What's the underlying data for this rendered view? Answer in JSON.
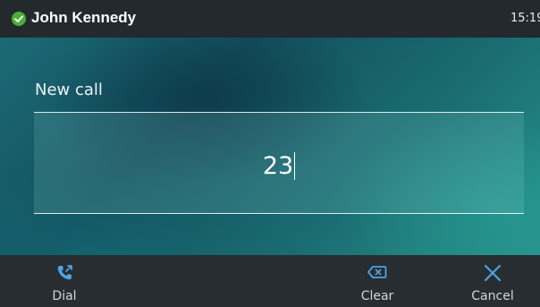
{
  "status_bar": {
    "user_name": "John Kennedy",
    "time": "15:19",
    "status_color": "#4caf32"
  },
  "main": {
    "prompt": "New call",
    "dial_value": "23"
  },
  "softkeys": [
    {
      "label": "Dial",
      "icon": "phone-icon"
    },
    {
      "label": "Clear",
      "icon": "backspace-icon"
    },
    {
      "label": "Cancel",
      "icon": "close-icon"
    }
  ],
  "colors": {
    "accent": "#4fa3e0",
    "softkey_bar": "#272d31",
    "status_bar": "#23292d"
  }
}
